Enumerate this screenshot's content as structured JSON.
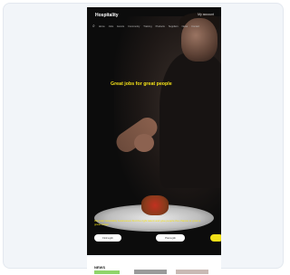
{
  "header": {
    "logo": "Hospitality",
    "account_link": "My account",
    "nav_items": [
      "Home",
      "Jobs",
      "Events",
      "Community",
      "Training",
      "Products",
      "Suppliers",
      "News",
      "Contact"
    ]
  },
  "hero": {
    "headline": "Great jobs for great people",
    "caption": "We help hospitality businesses find the right talent and give people the chance to grow a great career",
    "buttons": [
      "Find a job",
      "Post a job",
      ""
    ]
  },
  "below": {
    "section_title": "NEWS"
  },
  "colors": {
    "accent": "#f2e018",
    "background": "#0c0c0c",
    "card": "#f2f5f9"
  }
}
